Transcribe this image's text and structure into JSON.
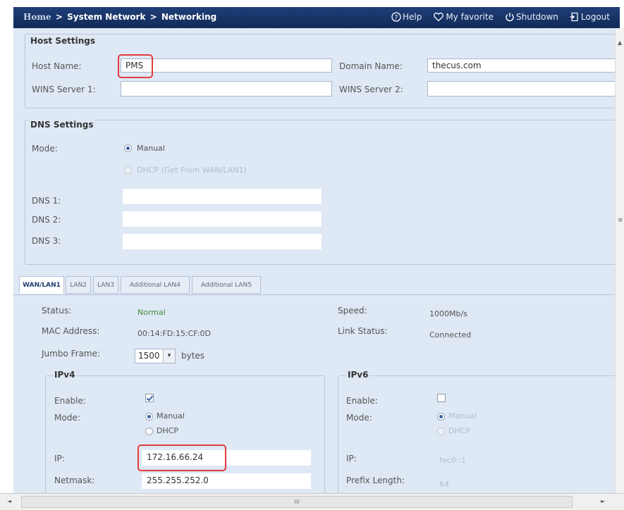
{
  "breadcrumb": {
    "home": "Home",
    "sep1": ">",
    "section": "System Network",
    "sep2": ">",
    "page": "Networking"
  },
  "topnav": {
    "help": "Help",
    "favorite": "My favorite",
    "shutdown": "Shutdown",
    "logout": "Logout"
  },
  "host": {
    "legend": "Host Settings",
    "host_name_label": "Host Name:",
    "host_name_value": "PMS",
    "domain_label": "Domain Name:",
    "domain_value": "thecus.com",
    "wins1_label": "WINS Server 1:",
    "wins1_value": "",
    "wins2_label": "WINS Server 2:",
    "wins2_value": ""
  },
  "dns": {
    "legend": "DNS Settings",
    "mode_label": "Mode:",
    "mode_manual": "Manual",
    "mode_dhcp": "DHCP (Get From WAN/LAN1)",
    "dns1_label": "DNS 1:",
    "dns2_label": "DNS 2:",
    "dns3_label": "DNS 3:"
  },
  "tabs": [
    "WAN/LAN1",
    "LAN2",
    "LAN3",
    "Additional LAN4",
    "Additional LAN5"
  ],
  "wan": {
    "status_label": "Status:",
    "status_value": "Normal",
    "mac_label": "MAC Address:",
    "mac_value": "00:14:FD:15:CF:0D",
    "jumbo_label": "Jumbo Frame:",
    "jumbo_value": "1500",
    "jumbo_unit": "bytes",
    "speed_label": "Speed:",
    "speed_value": "1000Mb/s",
    "link_label": "Link Status:",
    "link_value": "Connected"
  },
  "ipv4": {
    "legend": "IPv4",
    "enable_label": "Enable:",
    "mode_label": "Mode:",
    "mode_manual": "Manual",
    "mode_dhcp": "DHCP",
    "ip_label": "IP:",
    "ip_value": "172.16.66.24",
    "netmask_label": "Netmask:",
    "netmask_value": "255.255.252.0"
  },
  "ipv6": {
    "legend": "IPv6",
    "enable_label": "Enable:",
    "mode_label": "Mode:",
    "mode_manual": "Manual",
    "mode_dhcp": "DHCP",
    "ip_label": "IP:",
    "ip_value": "fec0::1",
    "prefix_label": "Prefix Length:",
    "prefix_value": "64"
  },
  "scrollbar": {
    "h_thumb": "III"
  },
  "colors": {
    "header": "#1a3568",
    "panel": "#dfe8f5",
    "highlight": "#e23b3b",
    "status_ok": "#3f8f3f"
  }
}
